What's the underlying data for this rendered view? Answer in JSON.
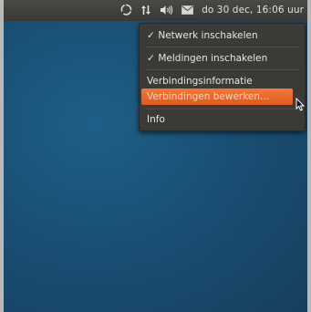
{
  "panel": {
    "icons": [
      "network-activity-icon",
      "network-updown-icon",
      "volume-icon",
      "mail-icon"
    ],
    "clock": "do 30 dec, 16:06 uur"
  },
  "menu": {
    "items": [
      {
        "label": "Netwerk inschakelen",
        "checked": true
      },
      {
        "label": "Meldingen inschakelen",
        "checked": true
      },
      {
        "label": "Verbindingsinformatie",
        "checked": false
      },
      {
        "label": "Verbindingen bewerken...",
        "checked": false,
        "highlighted": true
      },
      {
        "label": "Info",
        "checked": false
      }
    ]
  },
  "colors": {
    "panel": "#3a3935",
    "menu": "#3b3a37",
    "highlight": "#e0591f",
    "desktop": "#1a4f74"
  }
}
